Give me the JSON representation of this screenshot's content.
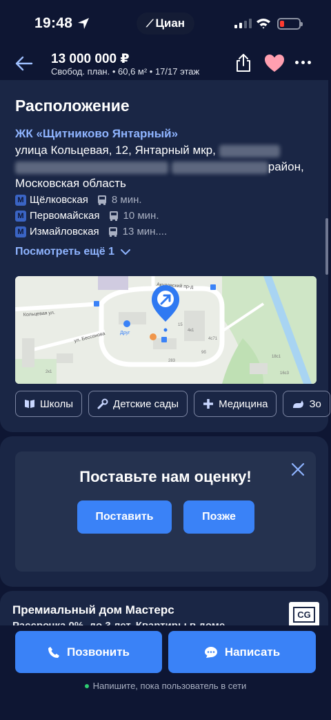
{
  "status_bar": {
    "time": "19:48",
    "app_label": "Циан"
  },
  "header": {
    "price": "13 000 000 ₽",
    "subtitle": "Свобод. план.  •  60,6 м²  •  17/17 этаж"
  },
  "location": {
    "title": "Расположение",
    "complex_name": "ЖК «Щитниково Янтарный»",
    "address_line1": "улица Кольцевая, 12, Янтарный мкр,",
    "address_district_suffix": "район,",
    "address_line3": "Московская область",
    "metro": [
      {
        "name": "Щёлковская",
        "time": "8 мин."
      },
      {
        "name": "Первомайская",
        "time": "10 мин."
      },
      {
        "name": "Измайловская",
        "time": "13 мин...."
      }
    ],
    "see_more": "Посмотреть ещё 1",
    "map_labels": {
      "street1": "Кольцевая ул.",
      "street2": "ул. Бессонова",
      "street3": "Акуловский пр-д",
      "poi": "Друг",
      "numbers": [
        "4к1",
        "4с71",
        "283",
        "2к1",
        "9б",
        "18с1",
        "16с3",
        "15"
      ]
    },
    "chips": [
      {
        "label": "Школы",
        "icon": "book-icon"
      },
      {
        "label": "Детские сады",
        "icon": "pacifier-icon"
      },
      {
        "label": "Медицина",
        "icon": "plus-icon"
      },
      {
        "label": "Зо",
        "icon": "pet-icon"
      }
    ]
  },
  "rating": {
    "title": "Поставьте нам оценку!",
    "rate_label": "Поставить",
    "later_label": "Позже"
  },
  "promo": {
    "title": "Премиальный дом Мастерс",
    "subtitle": "Рассрочка 0%, до 3 лет. Квартиры в доме",
    "logo_text": "CG"
  },
  "bottom": {
    "call_label": "Позвонить",
    "write_label": "Написать",
    "online_note": "Напишите, пока пользователь в сети"
  },
  "colors": {
    "background": "#0e1633",
    "card": "#1a2645",
    "accent": "#3a82f7",
    "link": "#8fb4ff",
    "heart": "#ff9fb0"
  }
}
